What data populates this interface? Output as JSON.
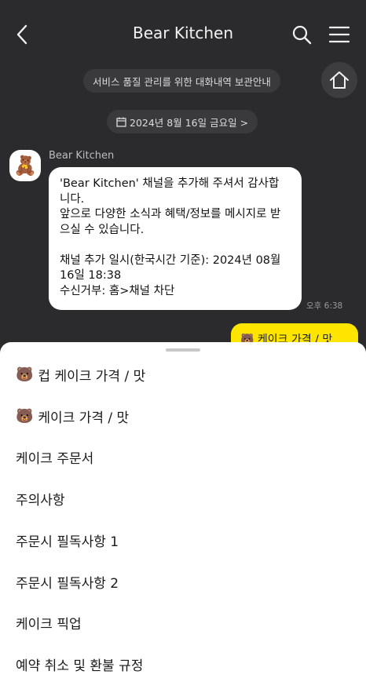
{
  "header": {
    "title": "Bear Kitchen"
  },
  "notice": {
    "text": "서비스 품질 관리를 위한 대화내역 보관안내"
  },
  "date_divider": {
    "text": "2024년 8월 16일 금요일 >"
  },
  "message": {
    "sender": "Bear Kitchen",
    "avatar_emoji": "🧸",
    "lines": [
      "'Bear Kitchen' 채널을 추가해 주셔서 감사합",
      "니다.",
      "앞으로 다양한 소식과 혜택/정보를 메시지로 받",
      "으실 수 있습니다.",
      "",
      "채널 추가 일시(한국시간 기준): 2024년 08월",
      "16일 18:38",
      "수신거부: 홈>채널 차단"
    ],
    "time": "오후 6:38"
  },
  "my_message": {
    "text": "🐻 케이크 가격 / 맛"
  },
  "menu": {
    "items": [
      {
        "emoji": "🐻",
        "label": "컵 케이크 가격 / 맛"
      },
      {
        "emoji": "🐻",
        "label": "케이크 가격 / 맛"
      },
      {
        "emoji": "",
        "label": "케이크 주문서"
      },
      {
        "emoji": "",
        "label": "주의사항"
      },
      {
        "emoji": "",
        "label": "주문시 필독사항 1"
      },
      {
        "emoji": "",
        "label": "주문시 필독사항 2"
      },
      {
        "emoji": "",
        "label": "케이크 픽업"
      },
      {
        "emoji": "",
        "label": "예약 취소 및 환불 규정"
      }
    ]
  },
  "colors": {
    "background": "#2b2b2d",
    "my_bubble": "#fee500",
    "sheet": "#ffffff"
  }
}
